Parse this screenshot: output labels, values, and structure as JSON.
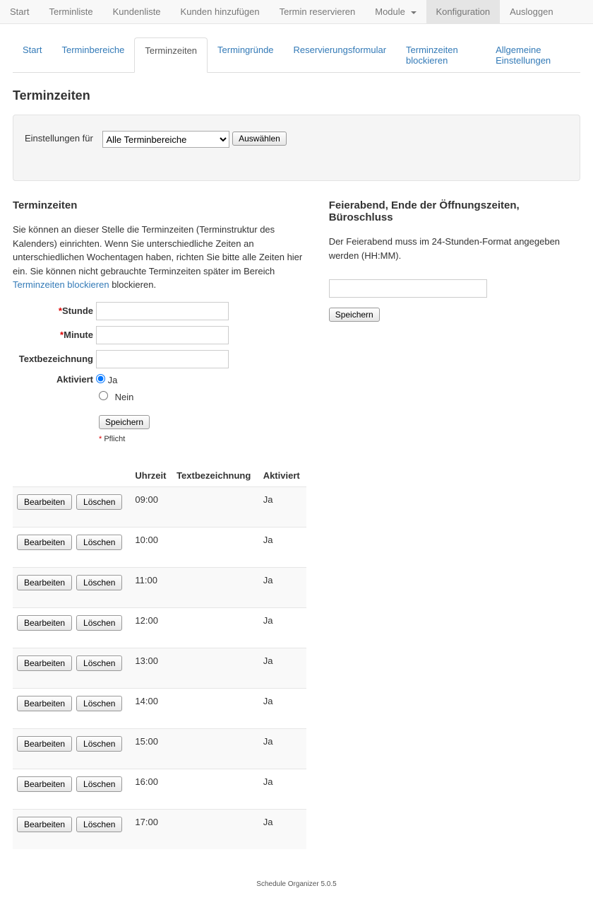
{
  "topnav": {
    "items": [
      "Start",
      "Terminliste",
      "Kundenliste",
      "Kunden hinzufügen",
      "Termin reservieren",
      "Module",
      "Konfiguration",
      "Ausloggen"
    ],
    "active_index": 6,
    "dropdown_index": 5
  },
  "subnav": {
    "items": [
      "Start",
      "Terminbereiche",
      "Terminzeiten",
      "Termingründe",
      "Reservierungsformular",
      "Terminzeiten blockieren",
      "Allgemeine Einstellungen"
    ],
    "active_index": 2
  },
  "page_title": "Terminzeiten",
  "settings_box": {
    "label": "Einstellungen für",
    "selected": "Alle Terminbereiche",
    "button": "Auswählen"
  },
  "left": {
    "title": "Terminzeiten",
    "desc1": "Sie können an dieser Stelle die Terminzeiten (Terminstruktur des Kalenders) einrichten. Wenn Sie unterschiedliche Zeiten an unterschiedlichen Wochentagen haben, richten Sie bitte alle Zeiten hier ein. Sie können nicht gebrauchte Terminzeiten später im Bereich ",
    "desc_link": "Terminzeiten blockieren",
    "desc2": " blockieren.",
    "fields": {
      "stunde_label": "Stunde",
      "minute_label": "Minute",
      "text_label": "Textbezeichnung",
      "aktiviert_label": "Aktiviert",
      "ja": "Ja",
      "nein": "Nein",
      "save": "Speichern",
      "required": "Pflicht"
    }
  },
  "right": {
    "title": "Feierabend, Ende der Öffnungszeiten, Büroschluss",
    "desc": "Der Feierabend muss im 24-Stunden-Format angegeben werden (HH:MM).",
    "save": "Speichern"
  },
  "table": {
    "edit": "Bearbeiten",
    "delete": "Löschen",
    "headers": {
      "uhrzeit": "Uhrzeit",
      "text": "Textbezeichnung",
      "aktiviert": "Aktiviert"
    },
    "rows": [
      {
        "uhrzeit": "09:00",
        "text": "",
        "aktiviert": "Ja"
      },
      {
        "uhrzeit": "10:00",
        "text": "",
        "aktiviert": "Ja"
      },
      {
        "uhrzeit": "11:00",
        "text": "",
        "aktiviert": "Ja"
      },
      {
        "uhrzeit": "12:00",
        "text": "",
        "aktiviert": "Ja"
      },
      {
        "uhrzeit": "13:00",
        "text": "",
        "aktiviert": "Ja"
      },
      {
        "uhrzeit": "14:00",
        "text": "",
        "aktiviert": "Ja"
      },
      {
        "uhrzeit": "15:00",
        "text": "",
        "aktiviert": "Ja"
      },
      {
        "uhrzeit": "16:00",
        "text": "",
        "aktiviert": "Ja"
      },
      {
        "uhrzeit": "17:00",
        "text": "",
        "aktiviert": "Ja"
      }
    ]
  },
  "footer": "Schedule Organizer 5.0.5"
}
